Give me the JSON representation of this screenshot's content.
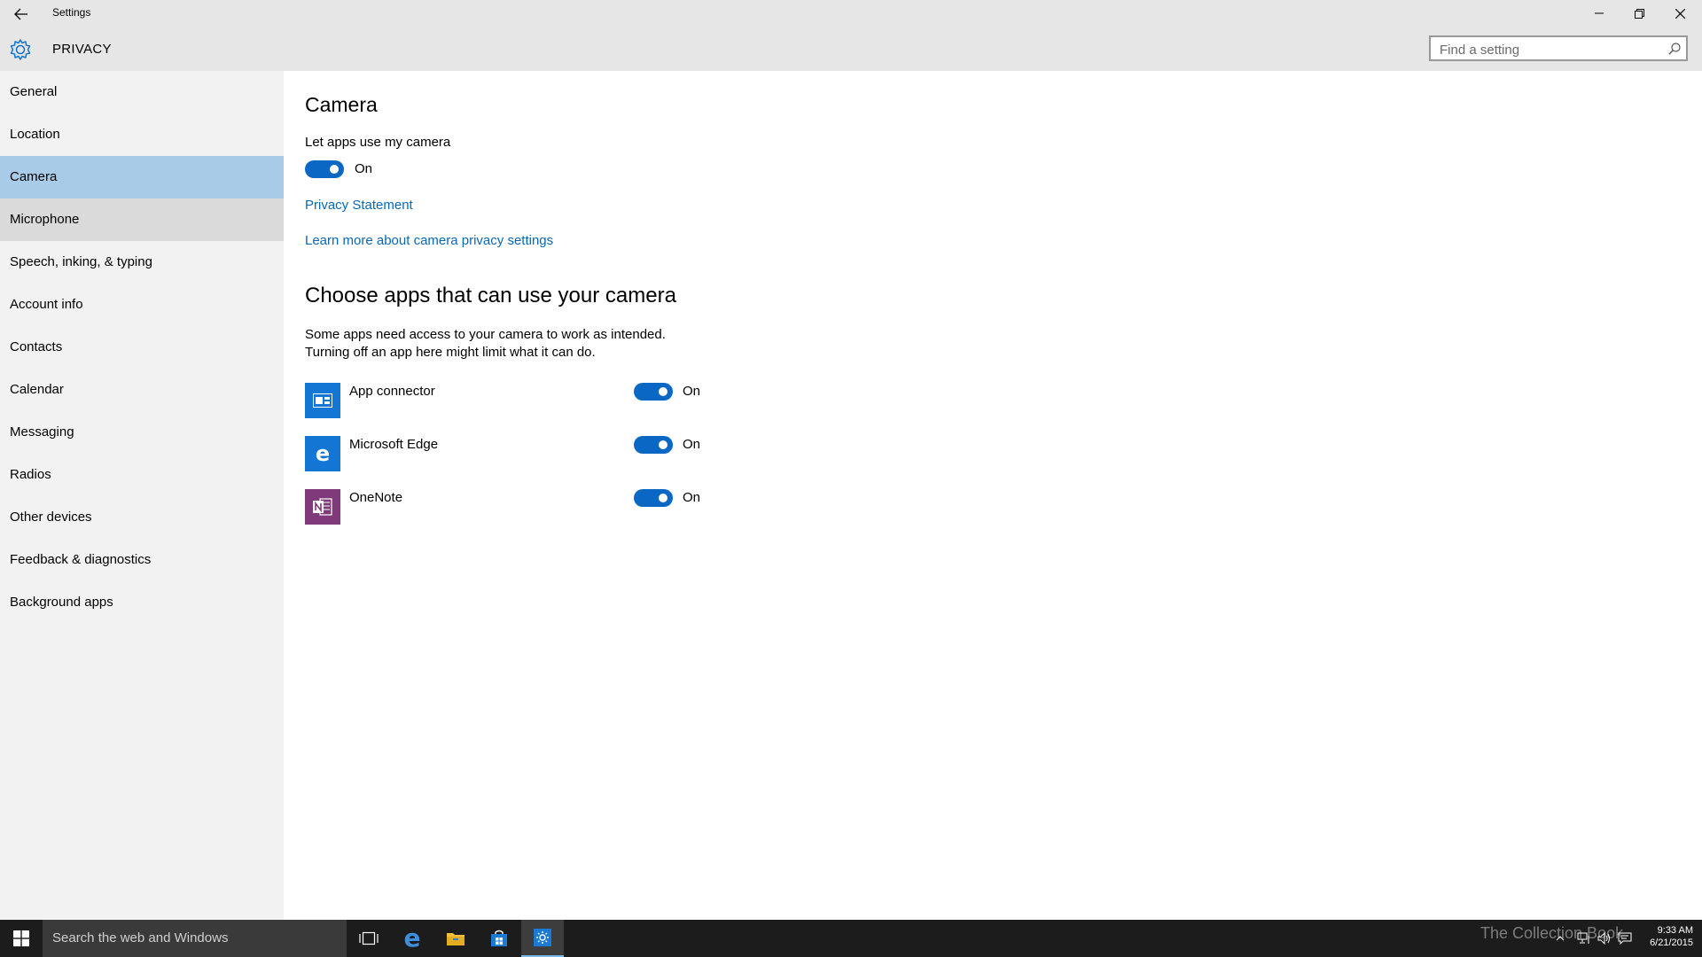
{
  "window": {
    "title": "Settings",
    "section": "PRIVACY",
    "search_placeholder": "Find a setting"
  },
  "sidebar": {
    "items": [
      {
        "label": "General"
      },
      {
        "label": "Location"
      },
      {
        "label": "Camera",
        "selected": true
      },
      {
        "label": "Microphone"
      },
      {
        "label": "Speech, inking, & typing"
      },
      {
        "label": "Account info"
      },
      {
        "label": "Contacts"
      },
      {
        "label": "Calendar"
      },
      {
        "label": "Messaging"
      },
      {
        "label": "Radios"
      },
      {
        "label": "Other devices"
      },
      {
        "label": "Feedback & diagnostics"
      },
      {
        "label": "Background apps"
      }
    ]
  },
  "main": {
    "heading": "Camera",
    "master_label": "Let apps use my camera",
    "master_state": "On",
    "privacy_link": "Privacy Statement",
    "learn_link": "Learn more about camera privacy settings",
    "apps_heading": "Choose apps that can use your camera",
    "apps_desc_1": "Some apps need access to your camera to work as intended.",
    "apps_desc_2": "Turning off an app here might limit what it can do.",
    "apps": [
      {
        "name": "App connector",
        "state": "On",
        "icon": "app-connector-icon",
        "color": "#1476d4"
      },
      {
        "name": "Microsoft Edge",
        "state": "On",
        "icon": "edge-icon",
        "color": "#1476d4"
      },
      {
        "name": "OneNote",
        "state": "On",
        "icon": "onenote-icon",
        "color": "#80397b"
      }
    ]
  },
  "taskbar": {
    "search_text": "Search the web and Windows",
    "time": "9:33 AM",
    "date": "6/21/2015",
    "watermark": "The Collection Book"
  },
  "colors": {
    "accent": "#0a68c4",
    "link": "#0a68b4",
    "selected_nav": "#a8cce8",
    "header_bg": "#e6e6e6",
    "sidebar_bg": "#f2f2f2",
    "taskbar_bg": "#1c1c1c"
  }
}
